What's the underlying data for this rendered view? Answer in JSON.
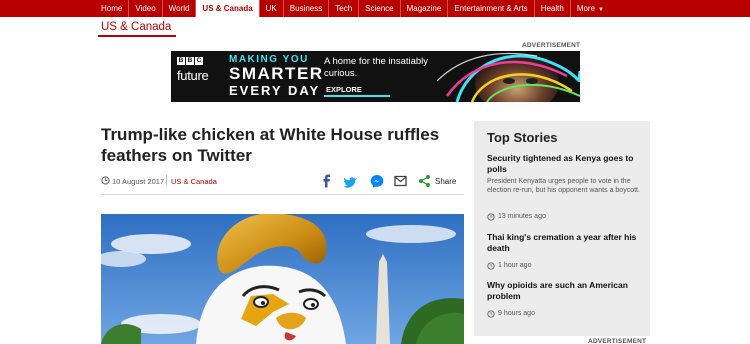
{
  "nav": {
    "items": [
      {
        "label": "Home"
      },
      {
        "label": "Video"
      },
      {
        "label": "World"
      },
      {
        "label": "US & Canada"
      },
      {
        "label": "UK"
      },
      {
        "label": "Business"
      },
      {
        "label": "Tech"
      },
      {
        "label": "Science"
      },
      {
        "label": "Magazine"
      },
      {
        "label": "Entertainment & Arts"
      },
      {
        "label": "Health"
      },
      {
        "label": "More"
      }
    ],
    "active_index": 3
  },
  "section": {
    "title": "US & Canada"
  },
  "ad_label": "ADVERTISEMENT",
  "banner": {
    "logo_letters": [
      "B",
      "B",
      "C"
    ],
    "brand": "future",
    "line1": "MAKING YOU",
    "line2": "SMARTER",
    "line3": "EVERY DAY",
    "tagline": "A home for the insatiably curious.",
    "cta": "EXPLORE"
  },
  "article": {
    "headline": "Trump-like chicken at White House ruffles feathers on Twitter",
    "date": "10 August 2017",
    "section_link": "US & Canada",
    "share_label": "Share"
  },
  "top_stories": {
    "title": "Top Stories",
    "stories": [
      {
        "headline": "Security tightened as Kenya goes to polls",
        "summary": "President Kenyatta urges people to vote in the election re-run, but his opponent wants a boycott.",
        "time": "13 minutes ago"
      },
      {
        "headline": "Thai king's cremation a year after his death",
        "time": "1 hour ago"
      },
      {
        "headline": "Why opioids are such an American problem",
        "time": "9 hours ago"
      }
    ]
  },
  "colors": {
    "brand_red": "#b80000",
    "ad_cyan": "#3fe3f6",
    "panel_grey": "#ececec"
  },
  "icons": [
    "facebook-icon",
    "twitter-icon",
    "messenger-icon",
    "email-icon",
    "share-icon",
    "clock-icon"
  ]
}
